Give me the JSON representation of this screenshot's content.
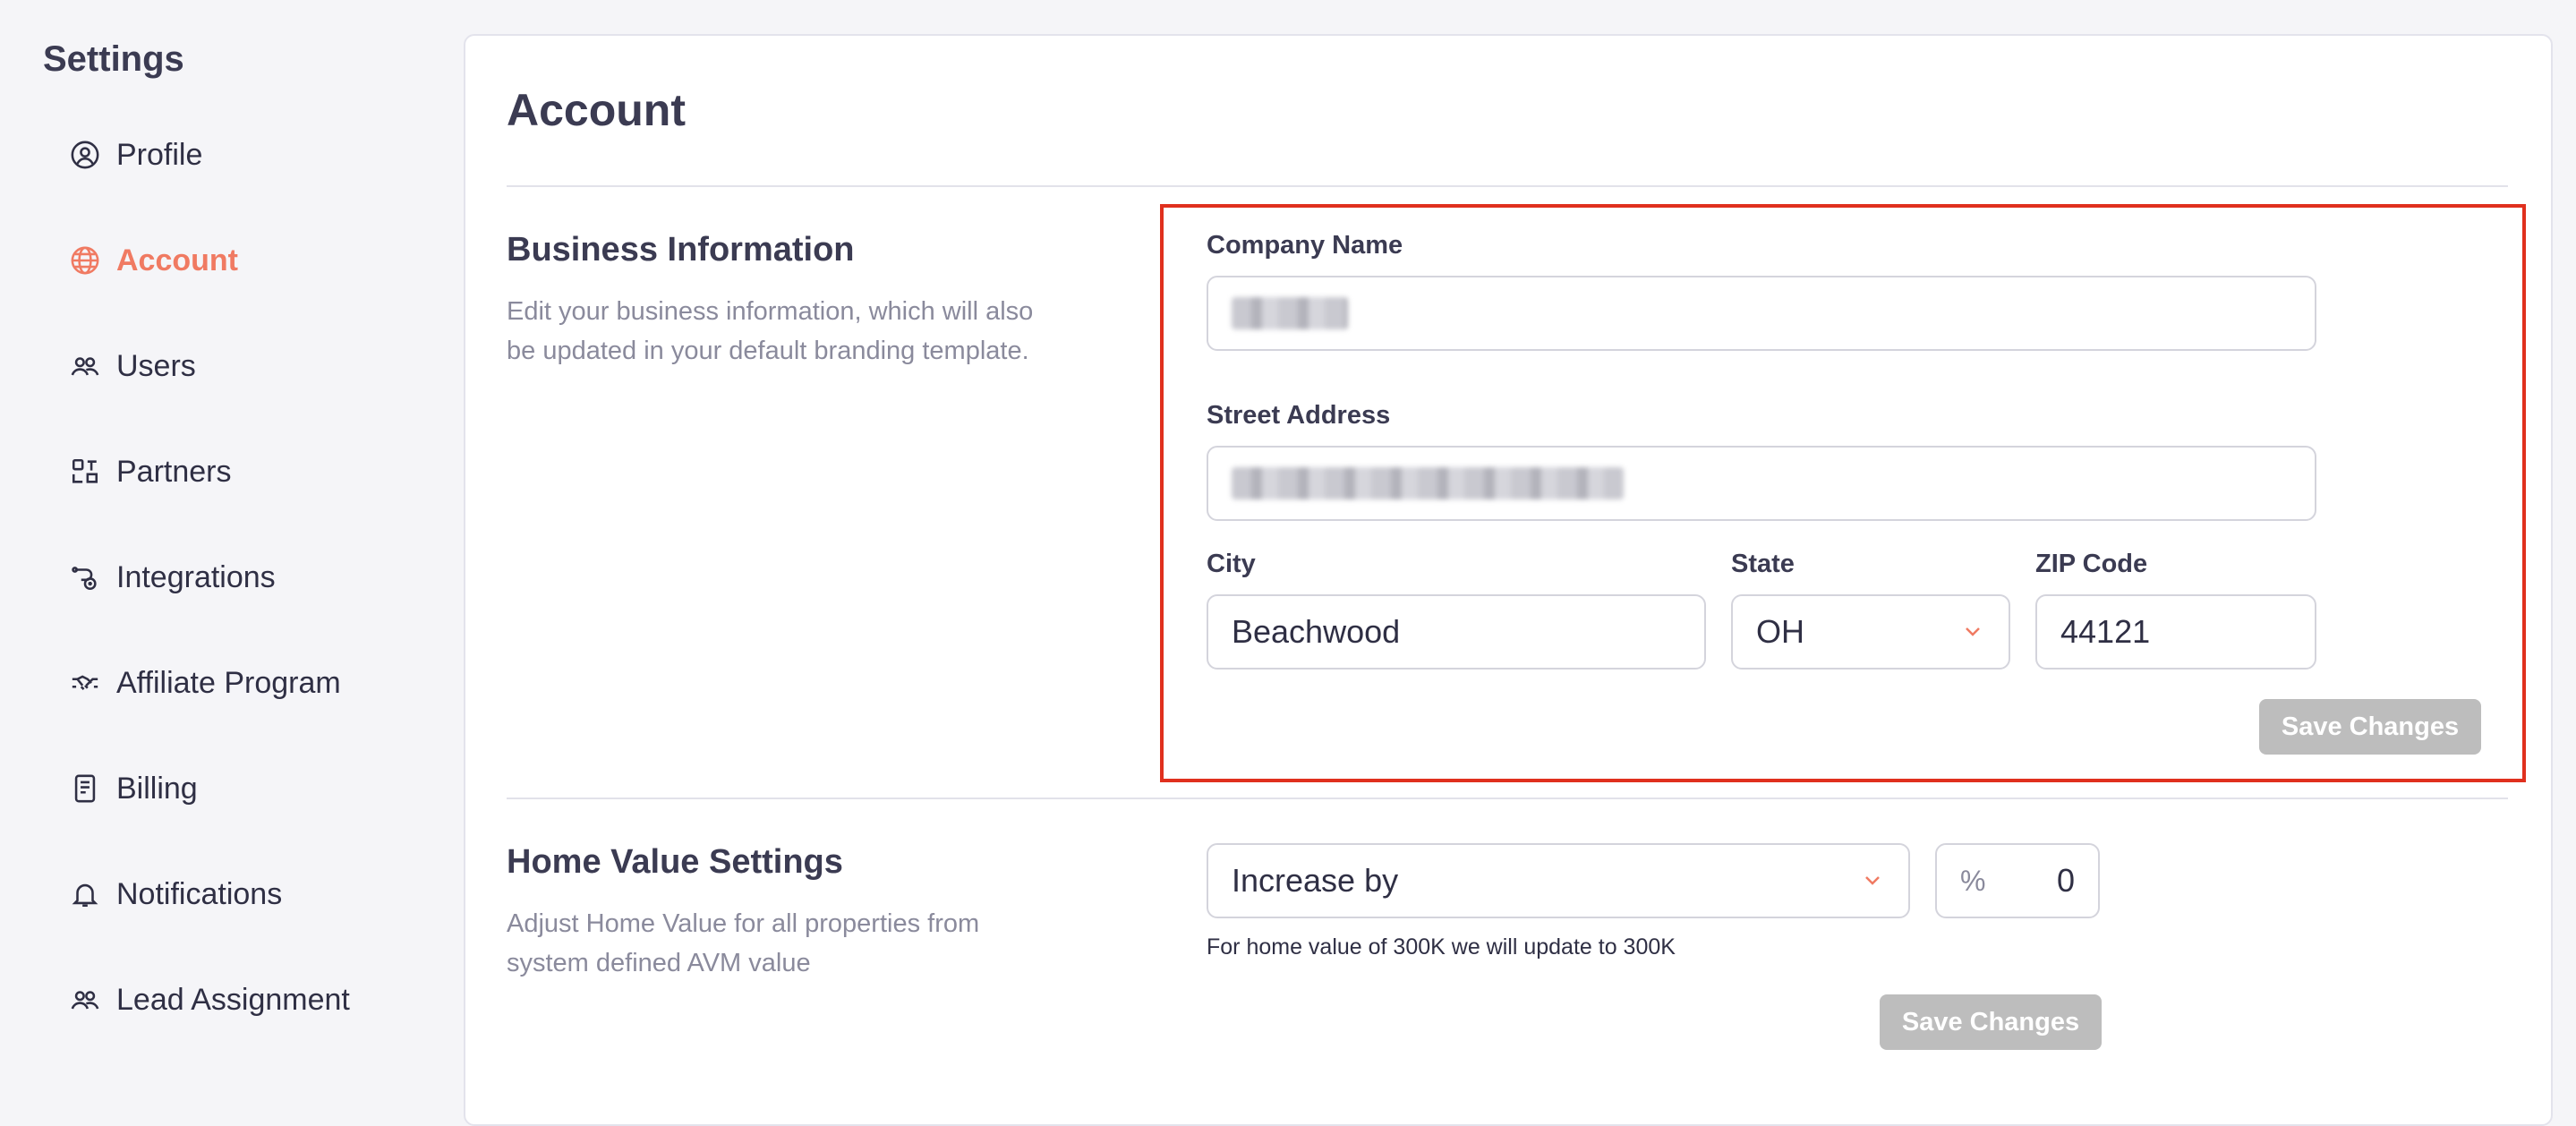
{
  "sidebar": {
    "title": "Settings",
    "items": [
      {
        "label": "Profile",
        "icon": "user-circle-icon"
      },
      {
        "label": "Account",
        "icon": "globe-icon"
      },
      {
        "label": "Users",
        "icon": "users-icon"
      },
      {
        "label": "Partners",
        "icon": "partners-icon"
      },
      {
        "label": "Integrations",
        "icon": "integrations-icon"
      },
      {
        "label": "Affiliate Program",
        "icon": "handshake-icon"
      },
      {
        "label": "Billing",
        "icon": "document-icon"
      },
      {
        "label": "Notifications",
        "icon": "bell-icon"
      },
      {
        "label": "Lead Assignment",
        "icon": "users-icon"
      }
    ],
    "active_index": 1
  },
  "page": {
    "title": "Account"
  },
  "business": {
    "title": "Business Information",
    "description": "Edit your business information, which will also be updated in your default branding template.",
    "company_label": "Company Name",
    "street_label": "Street Address",
    "city_label": "City",
    "city_value": "Beachwood",
    "state_label": "State",
    "state_value": "OH",
    "zip_label": "ZIP Code",
    "zip_value": "44121",
    "save_label": "Save Changes"
  },
  "home_value": {
    "title": "Home Value Settings",
    "description": "Adjust Home Value for all properties from system defined AVM value",
    "mode_value": "Increase by",
    "percent_symbol": "%",
    "percent_value": "0",
    "hint": "For home value of 300K we will update to 300K",
    "save_label": "Save Changes"
  },
  "colors": {
    "accent": "#f07a62",
    "highlight": "#e0301e",
    "disabled_button": "#bdbdbd"
  }
}
